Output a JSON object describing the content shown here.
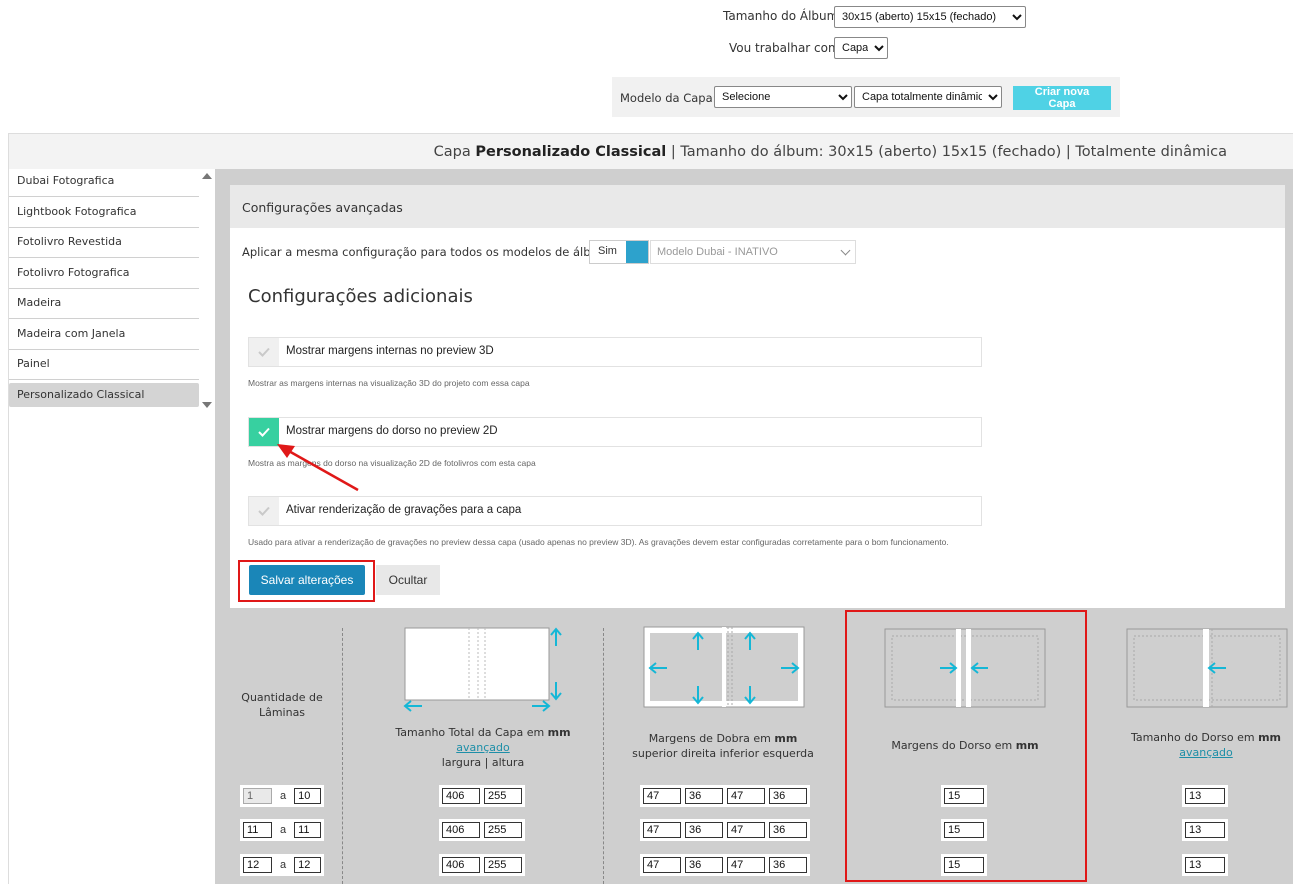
{
  "top": {
    "album_size_label": "Tamanho do Álbum:",
    "album_size_value": "30x15 (aberto) 15x15 (fechado)",
    "work_with_label": "Vou trabalhar com:",
    "work_with_value": "Capa",
    "cover_model_label": "Modelo da Capa:",
    "cover_model_value": "Selecione",
    "cover_type_value": "Capa totalmente dinâmica",
    "new_cover_button": "Criar nova Capa"
  },
  "header": {
    "prefix": "Capa ",
    "cover_name": "Personalizado Classical",
    "rest": " | Tamanho do álbum: 30x15 (aberto) 15x15 (fechado) | Totalmente dinâmica"
  },
  "sidebar": {
    "items": [
      {
        "label": "Dubai Fotografica"
      },
      {
        "label": "Lightbook Fotografica"
      },
      {
        "label": "Fotolivro Revestida"
      },
      {
        "label": "Fotolivro Fotografica"
      },
      {
        "label": "Madeira"
      },
      {
        "label": "Madeira com Janela"
      },
      {
        "label": "Painel"
      },
      {
        "label": "Personalizado Classical"
      }
    ]
  },
  "config": {
    "title": "Configurações avançadas",
    "apply_all_label": "Aplicar a mesma configuração para todos os modelos de álbuns?",
    "toggle_label": "Sim",
    "model_select": "Modelo Dubai - INATIVO",
    "section_title": "Configurações adicionais",
    "options": [
      {
        "label": "Mostrar margens internas no preview 3D",
        "help": "Mostrar as margens internas na visualização 3D do projeto com essa capa",
        "checked": false
      },
      {
        "label": "Mostrar margens do dorso no preview 2D",
        "help": "Mostra as margens do dorso na visualização 2D de fotolivros com esta capa",
        "checked": true
      },
      {
        "label": "Ativar renderização de gravações para a capa",
        "help": "Usado para ativar a renderização de gravações no preview dessa capa (usado apenas no preview 3D). As gravações devem estar configuradas corretamente para o bom funcionamento.",
        "checked": false
      }
    ],
    "save_button": "Salvar alterações",
    "hide_button": "Ocultar"
  },
  "table": {
    "col_qty": {
      "line1": "Quantidade de",
      "line2": "Lâminas"
    },
    "col_total": {
      "title": "Tamanho Total da Capa em ",
      "unit": "mm",
      "link": "avançado",
      "sub": "largura | altura"
    },
    "col_fold": {
      "title": "Margens de Dobra em ",
      "unit": "mm",
      "sub": "superior direita inferior esquerda"
    },
    "col_spine_margin": {
      "title": "Margens do Dorso em ",
      "unit": "mm"
    },
    "col_spine_size": {
      "title": "Tamanho do Dorso em ",
      "unit": "mm",
      "link": "avançado"
    },
    "range_sep": "a",
    "rows": [
      {
        "from": "1",
        "to": "10",
        "width": "406",
        "height": "255",
        "m1": "47",
        "m2": "36",
        "m3": "47",
        "m4": "36",
        "spine_margin": "15",
        "spine_size": "13"
      },
      {
        "from": "11",
        "to": "11",
        "width": "406",
        "height": "255",
        "m1": "47",
        "m2": "36",
        "m3": "47",
        "m4": "36",
        "spine_margin": "15",
        "spine_size": "13"
      },
      {
        "from": "12",
        "to": "12",
        "width": "406",
        "height": "255",
        "m1": "47",
        "m2": "36",
        "m3": "47",
        "m4": "36",
        "spine_margin": "15",
        "spine_size": "13"
      }
    ]
  },
  "colors": {
    "accent": "#1a86b8",
    "cyan": "#15b7d6",
    "check_on": "#37d0a0",
    "highlight": "#e01818"
  }
}
